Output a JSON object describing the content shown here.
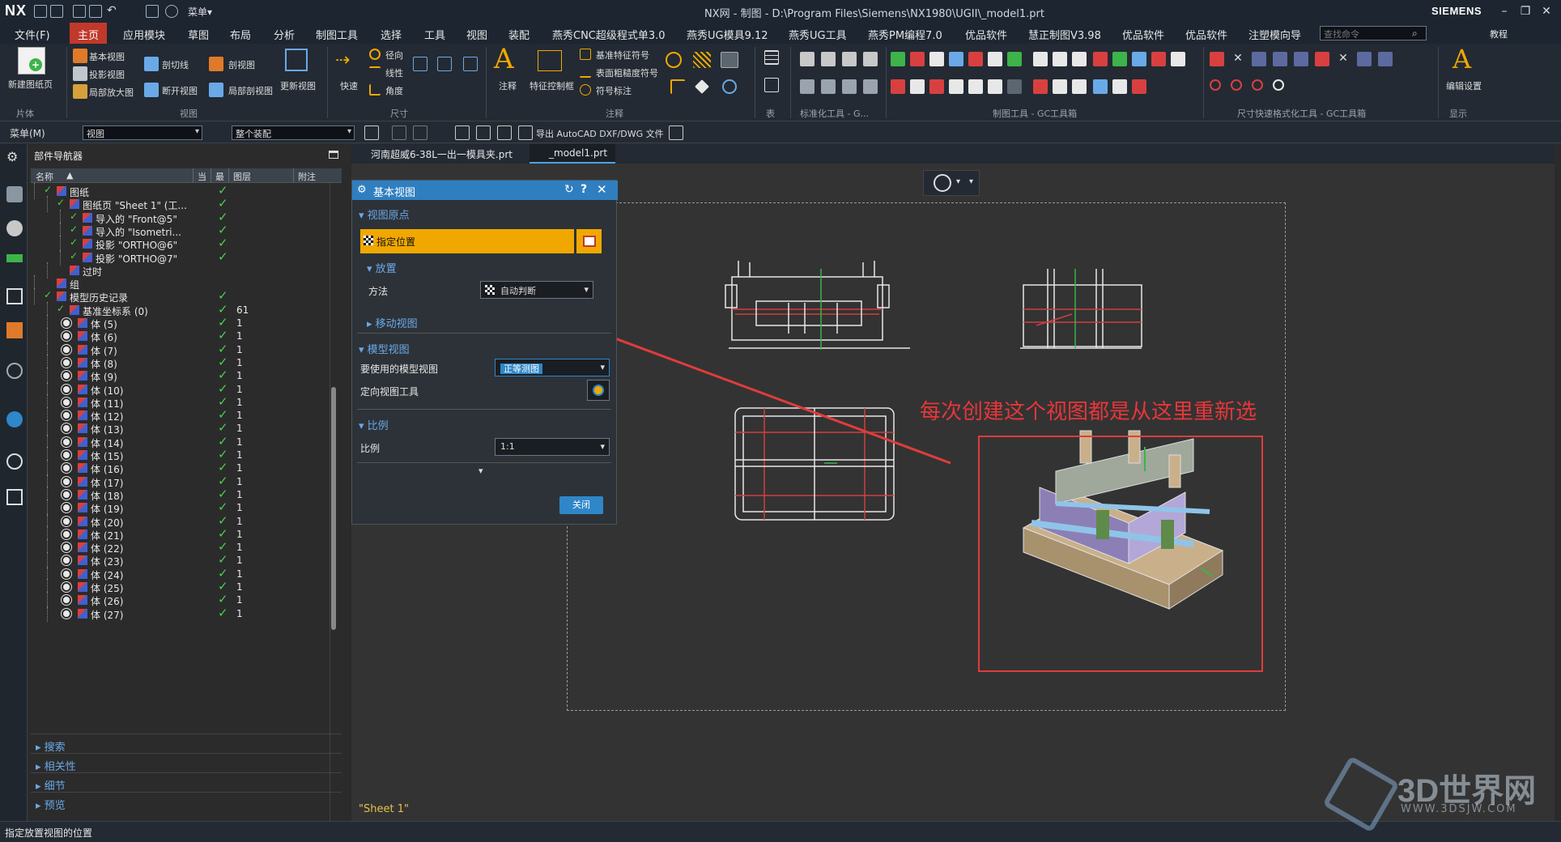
{
  "app": {
    "logo": "NX",
    "title": "NX网 - 制图 - D:\\Program Files\\Siemens\\NX1980\\UGII\\_model1.prt",
    "vendor": "SIEMENS",
    "menu_label": "菜单▾"
  },
  "menubar": {
    "items": [
      "文件(F)",
      "主页",
      "应用模块",
      "草图",
      "布局",
      "分析",
      "制图工具",
      "选择",
      "工具",
      "视图",
      "装配",
      "燕秀CNC超级程式单3.0",
      "燕秀UG模具9.12",
      "燕秀UG工具",
      "燕秀PM编程7.0",
      "优品软件",
      "慧正制图V3.98",
      "优品软件",
      "优品软件",
      "注塑模向导"
    ],
    "active_index": 1,
    "search_placeholder": "查找命令",
    "tutorial": "教程"
  },
  "ribbon": {
    "new_sheet": "新建图纸页",
    "sheet_group": "片体",
    "base_view": "基本视图",
    "projected_view": "投影视图",
    "detail_view": "局部放大图",
    "section_line": "剖切线",
    "break_view": "断开视图",
    "section_view": "剖视图",
    "break_out": "局部剖视图",
    "update_view": "更新视图",
    "view_group": "视图",
    "quick": "快速",
    "radial": "径向",
    "linear": "线性",
    "angle": "角度",
    "dim_group": "尺寸",
    "note": "注释",
    "feature_frame": "特征控制框",
    "datum_symbol": "基准特征符号",
    "surface_finish": "表面粗糙度符号",
    "symbol_note": "符号标注",
    "annot_group": "注释",
    "table_group": "表",
    "std_group": "标准化工具 - G...",
    "draft_group": "制图工具 - GC工具箱",
    "dim_fast_group": "尺寸快速格式化工具 - GC工具箱",
    "edit_settings": "编辑设置",
    "display_group": "显示"
  },
  "selbar": {
    "menu": "菜单(M)",
    "filter": "视图",
    "scope": "整个装配",
    "export": "导出 AutoCAD DXF/DWG 文件"
  },
  "navigator": {
    "title": "部件导航器",
    "columns": [
      "名称",
      "当",
      "最",
      "图层",
      "附注"
    ],
    "rows": [
      {
        "label": "图纸",
        "indent": 0,
        "check": true,
        "layer": ""
      },
      {
        "label": "图纸页 \"Sheet 1\" (工...",
        "indent": 1,
        "check": true,
        "layer": ""
      },
      {
        "label": "导入的 \"Front@5\"",
        "indent": 2,
        "check": true,
        "layer": ""
      },
      {
        "label": "导入的 \"Isometri...",
        "indent": 2,
        "check": true,
        "layer": ""
      },
      {
        "label": "投影 \"ORTHO@6\"",
        "indent": 2,
        "check": true,
        "layer": ""
      },
      {
        "label": "投影 \"ORTHO@7\"",
        "indent": 2,
        "check": true,
        "layer": ""
      },
      {
        "label": "过时",
        "indent": 1,
        "check": false,
        "layer": ""
      },
      {
        "label": "组",
        "indent": 0,
        "check": false,
        "layer": ""
      },
      {
        "label": "模型历史记录",
        "indent": 0,
        "check": true,
        "layer": ""
      },
      {
        "label": "基准坐标系 (0)",
        "indent": 1,
        "check": true,
        "layer": "61"
      },
      {
        "label": "体 (5)",
        "indent": 1,
        "check": true,
        "layer": "1"
      },
      {
        "label": "体 (6)",
        "indent": 1,
        "check": true,
        "layer": "1"
      },
      {
        "label": "体 (7)",
        "indent": 1,
        "check": true,
        "layer": "1"
      },
      {
        "label": "体 (8)",
        "indent": 1,
        "check": true,
        "layer": "1"
      },
      {
        "label": "体 (9)",
        "indent": 1,
        "check": true,
        "layer": "1"
      },
      {
        "label": "体 (10)",
        "indent": 1,
        "check": true,
        "layer": "1"
      },
      {
        "label": "体 (11)",
        "indent": 1,
        "check": true,
        "layer": "1"
      },
      {
        "label": "体 (12)",
        "indent": 1,
        "check": true,
        "layer": "1"
      },
      {
        "label": "体 (13)",
        "indent": 1,
        "check": true,
        "layer": "1"
      },
      {
        "label": "体 (14)",
        "indent": 1,
        "check": true,
        "layer": "1"
      },
      {
        "label": "体 (15)",
        "indent": 1,
        "check": true,
        "layer": "1"
      },
      {
        "label": "体 (16)",
        "indent": 1,
        "check": true,
        "layer": "1"
      },
      {
        "label": "体 (17)",
        "indent": 1,
        "check": true,
        "layer": "1"
      },
      {
        "label": "体 (18)",
        "indent": 1,
        "check": true,
        "layer": "1"
      },
      {
        "label": "体 (19)",
        "indent": 1,
        "check": true,
        "layer": "1"
      },
      {
        "label": "体 (20)",
        "indent": 1,
        "check": true,
        "layer": "1"
      },
      {
        "label": "体 (21)",
        "indent": 1,
        "check": true,
        "layer": "1"
      },
      {
        "label": "体 (22)",
        "indent": 1,
        "check": true,
        "layer": "1"
      },
      {
        "label": "体 (23)",
        "indent": 1,
        "check": true,
        "layer": "1"
      },
      {
        "label": "体 (24)",
        "indent": 1,
        "check": true,
        "layer": "1"
      },
      {
        "label": "体 (25)",
        "indent": 1,
        "check": true,
        "layer": "1"
      },
      {
        "label": "体 (26)",
        "indent": 1,
        "check": true,
        "layer": "1"
      },
      {
        "label": "体 (27)",
        "indent": 1,
        "check": true,
        "layer": "1"
      }
    ],
    "sections": [
      "搜索",
      "相关性",
      "细节",
      "预览"
    ]
  },
  "tabs": [
    {
      "label": "河南超威6-38L一出一模具夹.prt"
    },
    {
      "label": "_model1.prt"
    }
  ],
  "dialog": {
    "title": "基本视图",
    "sec_origin": "视图原点",
    "specify_location": "指定位置",
    "sec_placement": "放置",
    "method_label": "方法",
    "method_value": "自动判断",
    "move_view": "移动视图",
    "sec_model_view": "模型视图",
    "model_view_label": "要使用的模型视图",
    "model_view_value": "正等测图",
    "orient_tool": "定向视图工具",
    "sec_scale": "比例",
    "scale_label": "比例",
    "scale_value": "1:1",
    "close": "关闭"
  },
  "annotation": {
    "text": "每次创建这个视图都是从这里重新选",
    "color": "#e8363a"
  },
  "sheet_label": "\"Sheet 1\"",
  "status": "指定放置视图的位置",
  "watermark": {
    "brand": "3D世界网",
    "url": "WWW.3DSJW.COM"
  },
  "colors": {
    "accent": "#c0392b",
    "dialog_title": "#2f7fc0",
    "highlight": "#f0a800",
    "check": "#4cd04c"
  }
}
